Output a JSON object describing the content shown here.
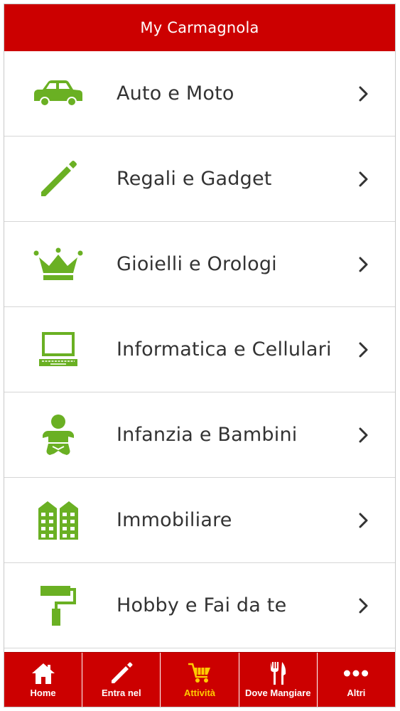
{
  "app": {
    "title": "My Carmagnola",
    "colors": {
      "brand": "#cc0000",
      "icon": "#6ab023",
      "active_tab": "#ffcc00"
    }
  },
  "menu": {
    "items": [
      {
        "label": "Auto e Moto",
        "icon": "car-icon"
      },
      {
        "label": "Regali e Gadget",
        "icon": "pencil-icon"
      },
      {
        "label": "Gioielli e Orologi",
        "icon": "crown-icon"
      },
      {
        "label": "Informatica e Cellulari",
        "icon": "laptop-icon"
      },
      {
        "label": "Infanzia e Bambini",
        "icon": "baby-icon"
      },
      {
        "label": "Immobiliare",
        "icon": "buildings-icon"
      },
      {
        "label": "Hobby e Fai da te",
        "icon": "paint-roller-icon"
      }
    ]
  },
  "tabbar": {
    "tabs": [
      {
        "label": "Home",
        "icon": "home-icon",
        "active": false
      },
      {
        "label": "Entra nel",
        "icon": "pencil-icon",
        "active": false
      },
      {
        "label": "Attività",
        "icon": "cart-icon",
        "active": true
      },
      {
        "label": "Dove Mangiare",
        "icon": "fork-knife-icon",
        "active": false
      },
      {
        "label": "Altri",
        "icon": "more-icon",
        "active": false
      }
    ]
  }
}
